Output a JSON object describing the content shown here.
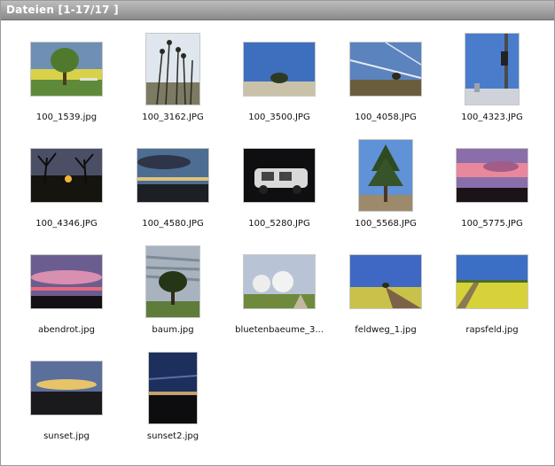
{
  "panel": {
    "title": "Dateien [1-17/17 ]"
  },
  "files": [
    {
      "name": "100_1539.jpg"
    },
    {
      "name": "100_3162.JPG"
    },
    {
      "name": "100_3500.JPG"
    },
    {
      "name": "100_4058.JPG"
    },
    {
      "name": "100_4323.JPG"
    },
    {
      "name": "100_4346.JPG"
    },
    {
      "name": "100_4580.JPG"
    },
    {
      "name": "100_5280.JPG"
    },
    {
      "name": "100_5568.JPG"
    },
    {
      "name": "100_5775.JPG"
    },
    {
      "name": "abendrot.jpg"
    },
    {
      "name": "baum.jpg"
    },
    {
      "name": "bluetenbaeume_3..."
    },
    {
      "name": "feldweg_1.jpg"
    },
    {
      "name": "rapsfeld.jpg"
    },
    {
      "name": "sunset.jpg"
    },
    {
      "name": "sunset2.jpg"
    }
  ]
}
